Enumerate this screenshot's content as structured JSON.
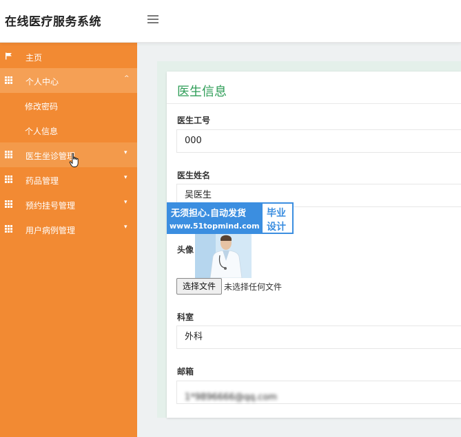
{
  "header": {
    "app_title": "在线医疗服务系统",
    "menu_icon": "hamburger-icon"
  },
  "sidebar": {
    "items": [
      {
        "label": "主页",
        "icon": "flag-icon"
      },
      {
        "label": "个人中心",
        "icon": "grid-icon",
        "caret": "^"
      },
      {
        "label": "修改密码"
      },
      {
        "label": "个人信息"
      },
      {
        "label": "医生坐诊管理",
        "icon": "grid-icon",
        "caret": "▾"
      },
      {
        "label": "药品管理",
        "icon": "grid-icon",
        "caret": "▾"
      },
      {
        "label": "预约挂号管理",
        "icon": "grid-icon",
        "caret": "▾"
      },
      {
        "label": "用户病例管理",
        "icon": "grid-icon",
        "caret": "▾"
      }
    ]
  },
  "form": {
    "title": "医生信息",
    "doctor_id": {
      "label": "医生工号",
      "value": "000"
    },
    "doctor_name": {
      "label": "医生姓名",
      "value": "吴医生"
    },
    "avatar": {
      "label": "头像",
      "file_button": "选择文件",
      "file_status": "未选择任何文件"
    },
    "department": {
      "label": "科室",
      "value": "外科"
    },
    "email": {
      "label": "邮箱",
      "value": "1*9896666@qq.com"
    }
  },
  "watermark": {
    "line1": "无须担心.自动发货",
    "line2": "www.51topmind.com",
    "right_top": "毕业",
    "right_bottom": "设计"
  },
  "colors": {
    "sidebar": "#f28a33",
    "accent_green": "#2e9d57",
    "watermark_blue": "#3b8ee0"
  }
}
